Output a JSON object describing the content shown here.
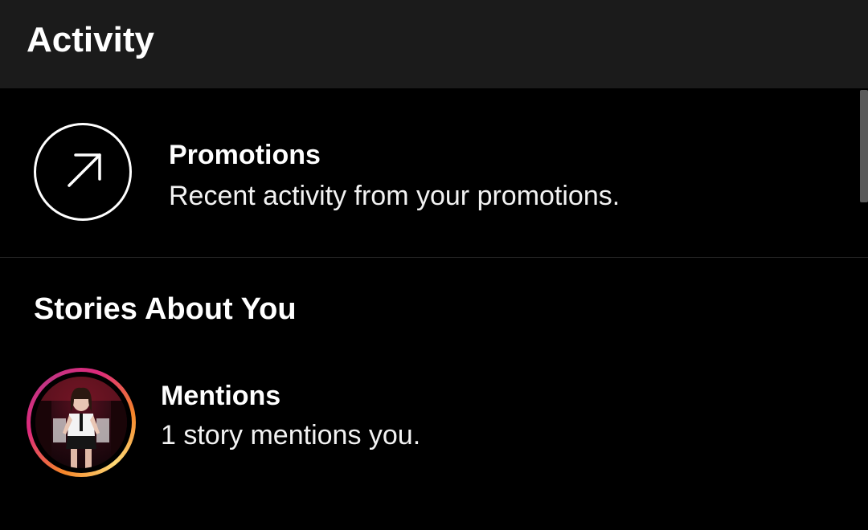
{
  "app_bar": {
    "title": "Activity"
  },
  "promotions": {
    "icon": "arrow-up-right-icon",
    "title": "Promotions",
    "subtitle": "Recent activity from your promotions."
  },
  "stories_section": {
    "title": "Stories About You"
  },
  "mentions": {
    "avatar": "story-avatar",
    "title": "Mentions",
    "subtitle": "1 story mentions you."
  },
  "colors": {
    "background": "#000000",
    "app_bar": "#1b1b1b",
    "text": "#ffffff",
    "story_ring_start": "#f58529",
    "story_ring_end": "#dd2a7b"
  }
}
